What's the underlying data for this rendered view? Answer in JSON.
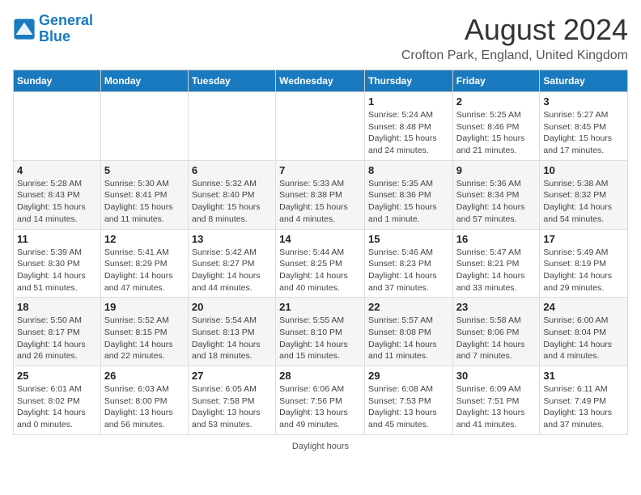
{
  "logo": {
    "line1": "General",
    "line2": "Blue"
  },
  "title": "August 2024",
  "subtitle": "Crofton Park, England, United Kingdom",
  "days_header": [
    "Sunday",
    "Monday",
    "Tuesday",
    "Wednesday",
    "Thursday",
    "Friday",
    "Saturday"
  ],
  "weeks": [
    [
      {
        "day": "",
        "info": ""
      },
      {
        "day": "",
        "info": ""
      },
      {
        "day": "",
        "info": ""
      },
      {
        "day": "",
        "info": ""
      },
      {
        "day": "1",
        "info": "Sunrise: 5:24 AM\nSunset: 8:48 PM\nDaylight: 15 hours and 24 minutes."
      },
      {
        "day": "2",
        "info": "Sunrise: 5:25 AM\nSunset: 8:46 PM\nDaylight: 15 hours and 21 minutes."
      },
      {
        "day": "3",
        "info": "Sunrise: 5:27 AM\nSunset: 8:45 PM\nDaylight: 15 hours and 17 minutes."
      }
    ],
    [
      {
        "day": "4",
        "info": "Sunrise: 5:28 AM\nSunset: 8:43 PM\nDaylight: 15 hours and 14 minutes."
      },
      {
        "day": "5",
        "info": "Sunrise: 5:30 AM\nSunset: 8:41 PM\nDaylight: 15 hours and 11 minutes."
      },
      {
        "day": "6",
        "info": "Sunrise: 5:32 AM\nSunset: 8:40 PM\nDaylight: 15 hours and 8 minutes."
      },
      {
        "day": "7",
        "info": "Sunrise: 5:33 AM\nSunset: 8:38 PM\nDaylight: 15 hours and 4 minutes."
      },
      {
        "day": "8",
        "info": "Sunrise: 5:35 AM\nSunset: 8:36 PM\nDaylight: 15 hours and 1 minute."
      },
      {
        "day": "9",
        "info": "Sunrise: 5:36 AM\nSunset: 8:34 PM\nDaylight: 14 hours and 57 minutes."
      },
      {
        "day": "10",
        "info": "Sunrise: 5:38 AM\nSunset: 8:32 PM\nDaylight: 14 hours and 54 minutes."
      }
    ],
    [
      {
        "day": "11",
        "info": "Sunrise: 5:39 AM\nSunset: 8:30 PM\nDaylight: 14 hours and 51 minutes."
      },
      {
        "day": "12",
        "info": "Sunrise: 5:41 AM\nSunset: 8:29 PM\nDaylight: 14 hours and 47 minutes."
      },
      {
        "day": "13",
        "info": "Sunrise: 5:42 AM\nSunset: 8:27 PM\nDaylight: 14 hours and 44 minutes."
      },
      {
        "day": "14",
        "info": "Sunrise: 5:44 AM\nSunset: 8:25 PM\nDaylight: 14 hours and 40 minutes."
      },
      {
        "day": "15",
        "info": "Sunrise: 5:46 AM\nSunset: 8:23 PM\nDaylight: 14 hours and 37 minutes."
      },
      {
        "day": "16",
        "info": "Sunrise: 5:47 AM\nSunset: 8:21 PM\nDaylight: 14 hours and 33 minutes."
      },
      {
        "day": "17",
        "info": "Sunrise: 5:49 AM\nSunset: 8:19 PM\nDaylight: 14 hours and 29 minutes."
      }
    ],
    [
      {
        "day": "18",
        "info": "Sunrise: 5:50 AM\nSunset: 8:17 PM\nDaylight: 14 hours and 26 minutes."
      },
      {
        "day": "19",
        "info": "Sunrise: 5:52 AM\nSunset: 8:15 PM\nDaylight: 14 hours and 22 minutes."
      },
      {
        "day": "20",
        "info": "Sunrise: 5:54 AM\nSunset: 8:13 PM\nDaylight: 14 hours and 18 minutes."
      },
      {
        "day": "21",
        "info": "Sunrise: 5:55 AM\nSunset: 8:10 PM\nDaylight: 14 hours and 15 minutes."
      },
      {
        "day": "22",
        "info": "Sunrise: 5:57 AM\nSunset: 8:08 PM\nDaylight: 14 hours and 11 minutes."
      },
      {
        "day": "23",
        "info": "Sunrise: 5:58 AM\nSunset: 8:06 PM\nDaylight: 14 hours and 7 minutes."
      },
      {
        "day": "24",
        "info": "Sunrise: 6:00 AM\nSunset: 8:04 PM\nDaylight: 14 hours and 4 minutes."
      }
    ],
    [
      {
        "day": "25",
        "info": "Sunrise: 6:01 AM\nSunset: 8:02 PM\nDaylight: 14 hours and 0 minutes."
      },
      {
        "day": "26",
        "info": "Sunrise: 6:03 AM\nSunset: 8:00 PM\nDaylight: 13 hours and 56 minutes."
      },
      {
        "day": "27",
        "info": "Sunrise: 6:05 AM\nSunset: 7:58 PM\nDaylight: 13 hours and 53 minutes."
      },
      {
        "day": "28",
        "info": "Sunrise: 6:06 AM\nSunset: 7:56 PM\nDaylight: 13 hours and 49 minutes."
      },
      {
        "day": "29",
        "info": "Sunrise: 6:08 AM\nSunset: 7:53 PM\nDaylight: 13 hours and 45 minutes."
      },
      {
        "day": "30",
        "info": "Sunrise: 6:09 AM\nSunset: 7:51 PM\nDaylight: 13 hours and 41 minutes."
      },
      {
        "day": "31",
        "info": "Sunrise: 6:11 AM\nSunset: 7:49 PM\nDaylight: 13 hours and 37 minutes."
      }
    ]
  ],
  "footer": "Daylight hours"
}
